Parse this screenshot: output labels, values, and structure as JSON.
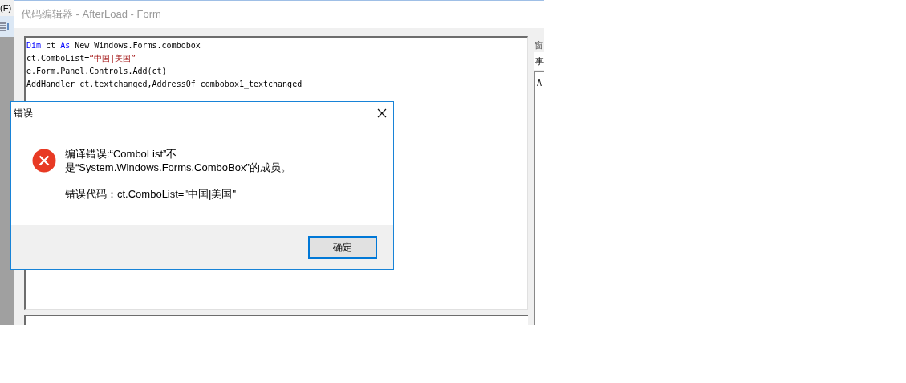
{
  "main_window": {
    "menu_item": "(F)"
  },
  "editor_window": {
    "title": "代码编辑器 - AfterLoad - Form",
    "code_lines": [
      [
        {
          "kind": "keyword",
          "text": "Dim"
        },
        {
          "kind": "plain",
          "text": " ct "
        },
        {
          "kind": "keyword",
          "text": "As"
        },
        {
          "kind": "plain",
          "text": " New Windows.Forms.combobox"
        }
      ],
      [
        {
          "kind": "plain",
          "text": "ct.ComboList="
        },
        {
          "kind": "string",
          "text": "“中国|美国”"
        }
      ],
      [
        {
          "kind": "plain",
          "text": "e.Form.Panel.Controls.Add(ct)"
        }
      ],
      [
        {
          "kind": "plain",
          "text": "AddHandler ct.textchanged,AddressOf combobox1_textchanged"
        }
      ]
    ],
    "side_panel": {
      "label": "窗",
      "tab": "事",
      "list_item": "A"
    }
  },
  "error_dialog": {
    "title": "错误",
    "message": "编译错误:“ComboList”不是“System.Windows.Forms.ComboBox”的成员。",
    "error_code": "错误代码：ct.ComboList=\"中国|美国\"",
    "ok_button": "确定"
  }
}
